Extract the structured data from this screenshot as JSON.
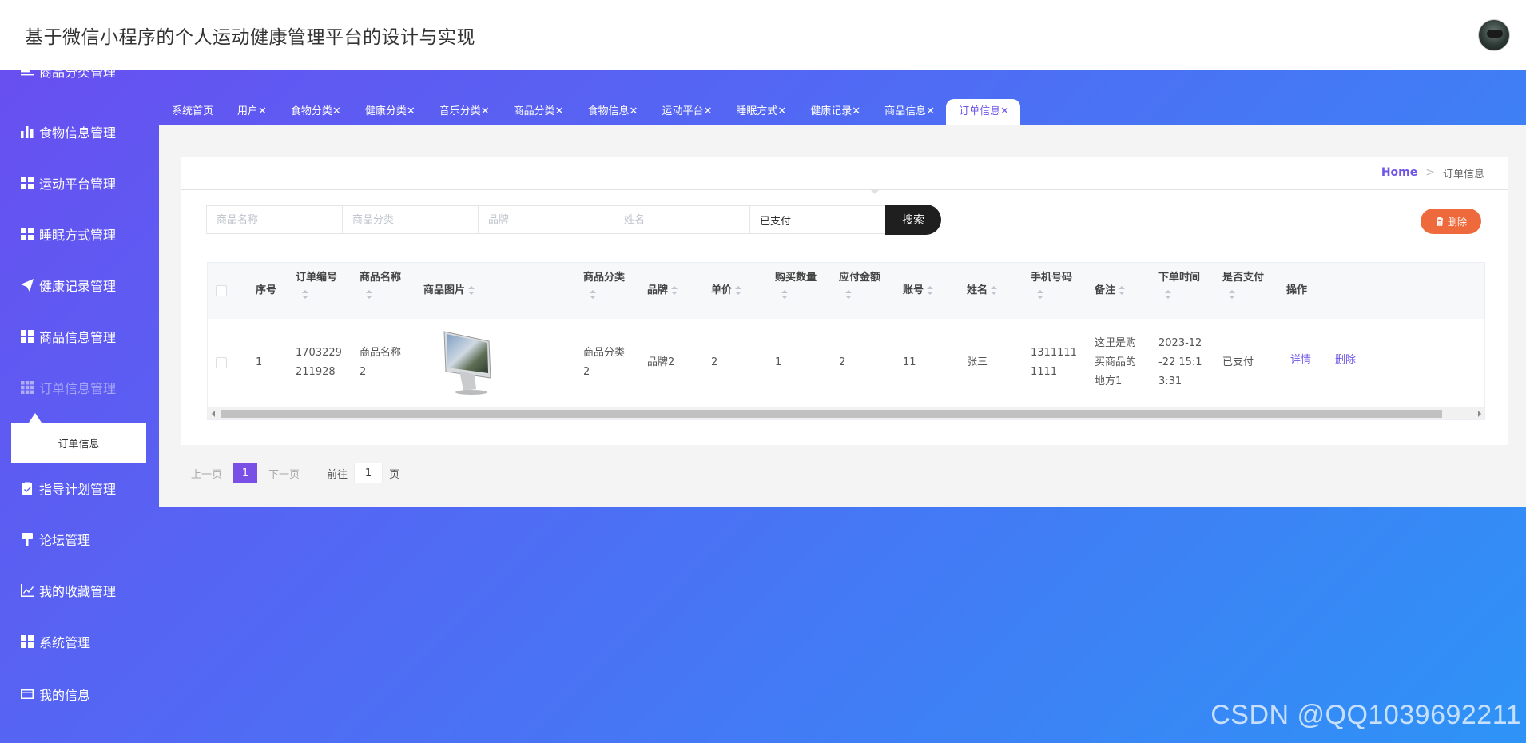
{
  "header": {
    "title": "基于微信小程序的个人运动健康管理平台的设计与实现"
  },
  "sidebar": {
    "items": [
      {
        "label": "商品分类管理",
        "icon": "list-icon"
      },
      {
        "label": "食物信息管理",
        "icon": "bar-chart-icon"
      },
      {
        "label": "运动平台管理",
        "icon": "grid-icon"
      },
      {
        "label": "睡眠方式管理",
        "icon": "grid-icon"
      },
      {
        "label": "健康记录管理",
        "icon": "paper-plane-icon"
      },
      {
        "label": "商品信息管理",
        "icon": "grid-icon"
      },
      {
        "label": "订单信息管理",
        "icon": "grid-9-icon"
      },
      {
        "label": "指导计划管理",
        "icon": "clipboard-check-icon"
      },
      {
        "label": "论坛管理",
        "icon": "brush-icon"
      },
      {
        "label": "我的收藏管理",
        "icon": "line-chart-icon"
      },
      {
        "label": "系统管理",
        "icon": "grid-icon"
      },
      {
        "label": "我的信息",
        "icon": "wallet-icon"
      }
    ],
    "submenu_label": "订单信息"
  },
  "tabs": [
    {
      "label": "系统首页"
    },
    {
      "label": "用户✕"
    },
    {
      "label": "食物分类✕"
    },
    {
      "label": "健康分类✕"
    },
    {
      "label": "音乐分类✕"
    },
    {
      "label": "商品分类✕"
    },
    {
      "label": "食物信息✕"
    },
    {
      "label": "运动平台✕"
    },
    {
      "label": "睡眠方式✕"
    },
    {
      "label": "健康记录✕"
    },
    {
      "label": "商品信息✕"
    },
    {
      "label": "订单信息✕",
      "active": true
    }
  ],
  "breadcrumb": {
    "home": "Home",
    "sep": ">",
    "current": "订单信息"
  },
  "search": {
    "product_name_placeholder": "商品名称",
    "category_placeholder": "商品分类",
    "brand_placeholder": "品牌",
    "name_placeholder": "姓名",
    "paid_value": "已支付",
    "search_label": "搜索"
  },
  "delete_label": "删除",
  "table": {
    "headers": {
      "index": "序号",
      "order_no": "订单编号",
      "product_name": "商品名称",
      "product_image": "商品图片",
      "category": "商品分类",
      "brand": "品牌",
      "price": "单价",
      "quantity": "购买数量",
      "amount": "应付金额",
      "account": "账号",
      "name": "姓名",
      "phone": "手机号码",
      "remark": "备注",
      "order_time": "下单时间",
      "paid": "是否支付",
      "action": "操作"
    },
    "row": {
      "index": "1",
      "order_no_l1": "1703229",
      "order_no_l2": "211928",
      "product_name_l1": "商品名称",
      "product_name_l2": "2",
      "category_l1": "商品分类",
      "category_l2": "2",
      "brand": "品牌2",
      "price": "2",
      "quantity": "1",
      "amount": "2",
      "account": "11",
      "name": "张三",
      "phone_l1": "1311111",
      "phone_l2": "1111",
      "remark_l1": "这里是购",
      "remark_l2": "买商品的",
      "remark_l3": "地方1",
      "time_l1": "2023-12",
      "time_l2": "-22 15:1",
      "time_l3": "3:31",
      "paid": "已支付",
      "detail_label": "详情",
      "delete_label": "删除"
    }
  },
  "pager": {
    "prev": "上一页",
    "current": "1",
    "next": "下一页",
    "goto": "前往",
    "goto_value": "1",
    "unit": "页"
  },
  "watermark": "CSDN @QQ1039692211",
  "colors": {
    "accent": "#6f55e8",
    "delete": "#ee6a3c",
    "page_active": "#7a4fe6"
  }
}
